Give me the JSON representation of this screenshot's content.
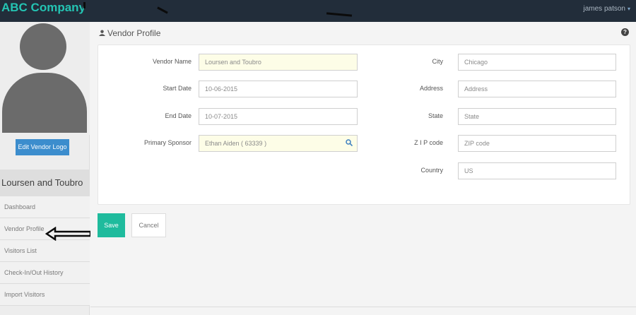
{
  "header": {
    "brand": "ABC Company",
    "user": "james patson",
    "user_caret": "▾"
  },
  "sidebar": {
    "edit_logo_label": "Edit Vendor Logo",
    "vendor_name": "Loursen and Toubro",
    "items": [
      {
        "label": "Dashboard"
      },
      {
        "label": "Vendor Profile"
      },
      {
        "label": "Visitors List"
      },
      {
        "label": "Check-In/Out History"
      },
      {
        "label": "Import Visitors"
      }
    ]
  },
  "main": {
    "title": "Vendor Profile",
    "help_icon": "?",
    "form": {
      "vendor_name": {
        "label": "Vendor Name",
        "value": "Loursen and Toubro"
      },
      "start_date": {
        "label": "Start Date",
        "value": "10-06-2015"
      },
      "end_date": {
        "label": "End Date",
        "value": "10-07-2015"
      },
      "primary_sponsor": {
        "label": "Primary Sponsor",
        "value": "Ethan Aiden ( 63339 )"
      },
      "city": {
        "label": "City",
        "value": "Chicago"
      },
      "address": {
        "label": "Address",
        "placeholder": "Address"
      },
      "state": {
        "label": "State",
        "placeholder": "State"
      },
      "zip": {
        "label": "Z I P code",
        "placeholder": "ZIP code"
      },
      "country": {
        "label": "Country",
        "value": "US"
      }
    },
    "save_label": "Save",
    "cancel_label": "Cancel"
  },
  "colors": {
    "topbar": "#222d3a",
    "brand": "#24c4b3",
    "save": "#1fbb9d",
    "edit_logo": "#3c8dcd"
  },
  "icons": {
    "user": "user-icon",
    "help": "help-icon",
    "search": "search-icon",
    "annotation": "arrow-left-icon"
  }
}
